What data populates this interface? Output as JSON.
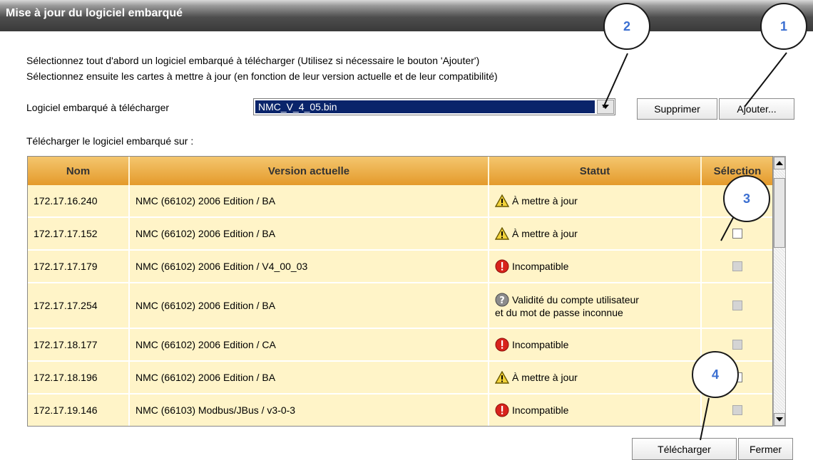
{
  "window": {
    "title": "Mise à jour du logiciel embarqué"
  },
  "instructions": [
    "Sélectionnez tout d'abord un logiciel embarqué à télécharger (Utilisez si nécessaire le bouton 'Ajouter')",
    "Sélectionnez ensuite les cartes à mettre à jour (en fonction de leur version actuelle et de leur compatibilité)"
  ],
  "firmware": {
    "label": "Logiciel embarqué à télécharger",
    "selected": "NMC_V_4_05.bin"
  },
  "buttons": {
    "delete": "Supprimer",
    "add": "Ajouter...",
    "download": "Télécharger",
    "close": "Fermer"
  },
  "target_label": "Télécharger le logiciel embarqué sur :",
  "table": {
    "headers": [
      "Nom",
      "Version actuelle",
      "Statut",
      "Sélection"
    ],
    "rows": [
      {
        "name": "172.17.16.240",
        "version": "NMC (66102) 2006 Edition / BA",
        "status": "À mettre à jour",
        "status_icon": "warning-icon",
        "selectable": true
      },
      {
        "name": "172.17.17.152",
        "version": "NMC (66102) 2006 Edition / BA",
        "status": "À mettre à jour",
        "status_icon": "warning-icon",
        "selectable": true
      },
      {
        "name": "172.17.17.179",
        "version": "NMC (66102) 2006 Edition / V4_00_03",
        "status": "Incompatible",
        "status_icon": "error-icon",
        "selectable": false
      },
      {
        "name": "172.17.17.254",
        "version": "NMC (66102) 2006 Edition / BA",
        "status": "Validité du compte utilisateur",
        "status_line2": "et du mot de passe inconnue",
        "status_icon": "unknown-icon",
        "selectable": false
      },
      {
        "name": "172.17.18.177",
        "version": "NMC (66102) 2006 Edition / CA",
        "status": "Incompatible",
        "status_icon": "error-icon",
        "selectable": false
      },
      {
        "name": "172.17.18.196",
        "version": "NMC (66102) 2006 Edition / BA",
        "status": "À mettre à jour",
        "status_icon": "warning-icon",
        "selectable": true
      },
      {
        "name": "172.17.19.146",
        "version": "NMC (66103) Modbus/JBus / v3-0-3",
        "status": "Incompatible",
        "status_icon": "error-icon",
        "selectable": false
      }
    ]
  },
  "callouts": [
    "1",
    "2",
    "3",
    "4"
  ],
  "colors": {
    "header": "#e8a33a",
    "row": "#fff4c8",
    "selection": "#0a246a",
    "callout_text": "#3b6fd1"
  }
}
